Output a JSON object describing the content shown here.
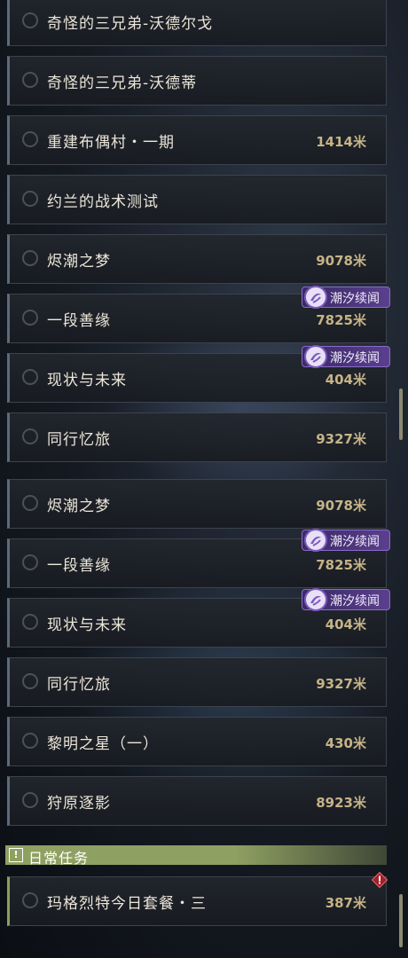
{
  "quests_top": [
    {
      "title": "奇怪的三兄弟-沃德尔戈",
      "distance": ""
    },
    {
      "title": "奇怪的三兄弟-沃德蒂",
      "distance": ""
    },
    {
      "title": "重建布偶村・一期",
      "distance": "1414米"
    },
    {
      "title": "约兰的战术测试",
      "distance": ""
    },
    {
      "title": "烬潮之梦",
      "distance": "9078米"
    },
    {
      "title": "一段善缘",
      "distance": "7825米"
    },
    {
      "title": "现状与未来",
      "distance": "404米"
    },
    {
      "title": "同行忆旅",
      "distance": "9327米"
    }
  ],
  "quests_bottom": [
    {
      "title": "烬潮之梦",
      "distance": "9078米"
    },
    {
      "title": "一段善缘",
      "distance": "7825米"
    },
    {
      "title": "现状与未来",
      "distance": "404米"
    },
    {
      "title": "同行忆旅",
      "distance": "9327米"
    },
    {
      "title": "黎明之星（一）",
      "distance": "430米"
    },
    {
      "title": "狩原逐影",
      "distance": "8923米"
    }
  ],
  "badge_label": "潮汐续闻",
  "section": {
    "icon": "!",
    "label": "日常任务"
  },
  "daily_quest": {
    "title": "玛格烈特今日套餐・三",
    "distance": "387米"
  },
  "colors": {
    "accent_green": "#8fa162",
    "badge_purple": "#5a3f8e",
    "distance_gold": "#c6b387",
    "alert_red": "#a3202a"
  }
}
